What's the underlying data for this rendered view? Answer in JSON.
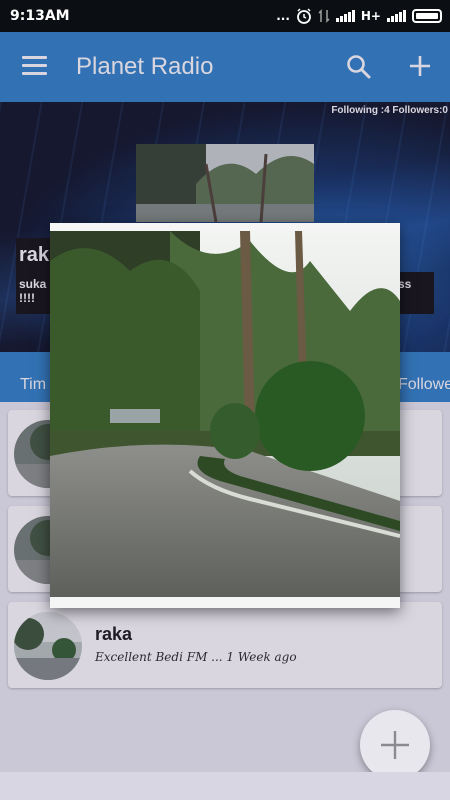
{
  "status_bar": {
    "time": "9:13AM",
    "dots": "...",
    "network_type": "H+",
    "icons": [
      "alarm-icon",
      "data-arrows-icon",
      "signal-icon",
      "signal-icon",
      "battery-icon"
    ]
  },
  "app_bar": {
    "title": "Planet Radio",
    "menu_icon": "hamburger-menu-icon",
    "search_icon": "search-icon",
    "add_icon": "plus-icon",
    "color": "#2a7fc8"
  },
  "profile": {
    "stats": "Following :4 Followers:0",
    "name": "rak",
    "bio_start": "suka",
    "bio_end": "ss",
    "bio_second_line": "!!!!"
  },
  "tabs": {
    "timeline": "Tim",
    "followers": "Follower"
  },
  "posts": [
    {
      "user": "",
      "meta": ""
    },
    {
      "user": "",
      "meta": ""
    },
    {
      "user": "raka",
      "meta": "Excellent Bedi FM ... 1 Week ago"
    }
  ],
  "fab_icon": "plus-icon",
  "colors": {
    "accent": "#2a7fc8",
    "status_bar": "#0b0f14",
    "overlay": "#504670"
  }
}
